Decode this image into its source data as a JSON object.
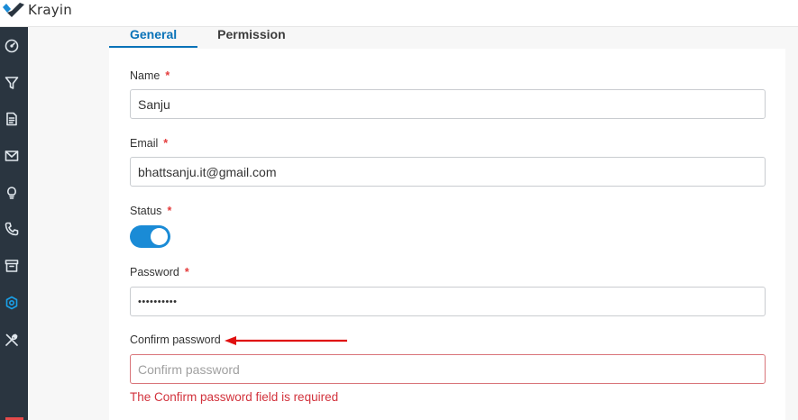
{
  "app": {
    "name": "Krayin"
  },
  "sidebar": {
    "items": [
      {
        "name": "dashboard",
        "icon": "dashboard-icon"
      },
      {
        "name": "leads",
        "icon": "filter-icon"
      },
      {
        "name": "quotes",
        "icon": "document-icon"
      },
      {
        "name": "mail",
        "icon": "mail-icon"
      },
      {
        "name": "activities",
        "icon": "lightbulb-icon"
      },
      {
        "name": "contacts",
        "icon": "phone-icon"
      },
      {
        "name": "products",
        "icon": "archive-icon"
      },
      {
        "name": "settings",
        "icon": "gear-icon",
        "active": true
      },
      {
        "name": "configuration",
        "icon": "tools-icon"
      }
    ]
  },
  "tabs": [
    {
      "label": "General",
      "active": true
    },
    {
      "label": "Permission",
      "active": false
    }
  ],
  "form": {
    "name": {
      "label": "Name",
      "required_mark": "*",
      "value": "Sanju"
    },
    "email": {
      "label": "Email",
      "required_mark": "*",
      "value": "bhattsanju.it@gmail.com"
    },
    "status": {
      "label": "Status",
      "required_mark": "*",
      "enabled": true
    },
    "password": {
      "label": "Password",
      "required_mark": "*",
      "value": "••••••••••"
    },
    "confirm_password": {
      "label": "Confirm password",
      "placeholder": "Confirm password",
      "value": "",
      "error": "The Confirm password field is required"
    }
  },
  "colors": {
    "accent": "#0a73b8",
    "toggle_on": "#1a8bd6",
    "required": "#e43b3b",
    "error": "#d2323c",
    "sidebar_bg": "#2a3540"
  }
}
